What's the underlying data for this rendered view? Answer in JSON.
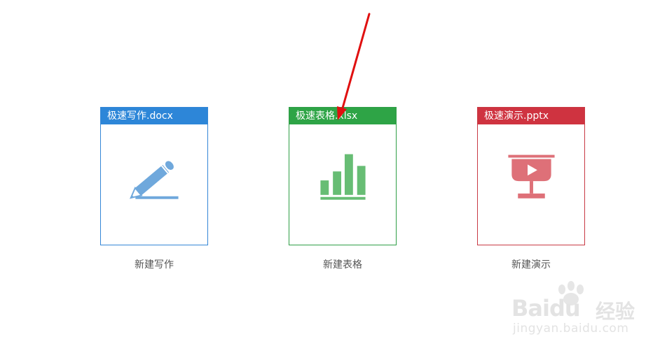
{
  "cards": [
    {
      "header": "极速写作.docx",
      "caption": "新建写作",
      "icon": "pen-icon",
      "header_color": "#2d86d8",
      "icon_color": "#6fa8dc"
    },
    {
      "header": "极速表格.xlsx",
      "caption": "新建表格",
      "icon": "bar-chart-icon",
      "header_color": "#2ea446",
      "icon_color": "#67bd74"
    },
    {
      "header": "极速演示.pptx",
      "caption": "新建演示",
      "icon": "presentation-icon",
      "header_color": "#cf3340",
      "icon_color": "#de7078"
    }
  ],
  "annotation": {
    "arrow_color": "#e01010"
  },
  "watermark": {
    "brand": "Bai",
    "brand_suffix": "du",
    "brand_cn": "经验",
    "url": "jingyan.baidu.com"
  }
}
